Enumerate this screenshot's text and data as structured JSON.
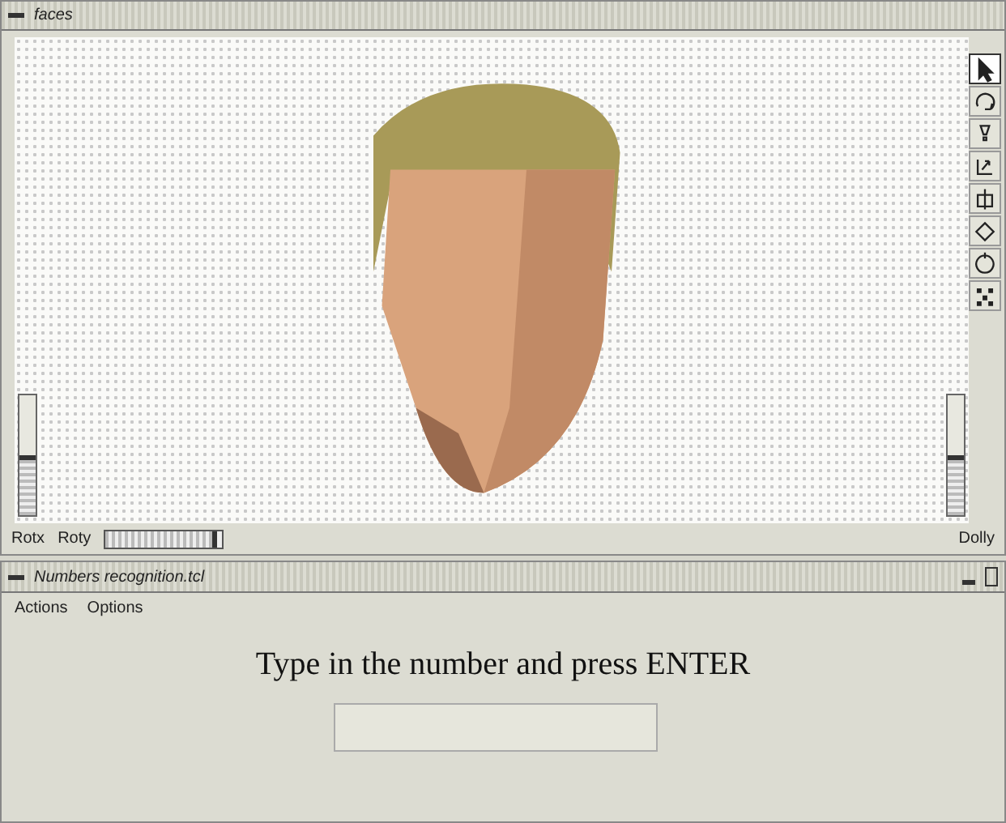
{
  "viewer_window": {
    "title": "faces",
    "tools": [
      {
        "kind": "pointer",
        "selected": true
      },
      {
        "kind": "rotate",
        "selected": false
      },
      {
        "kind": "light",
        "selected": false
      },
      {
        "kind": "zoom",
        "selected": false
      },
      {
        "kind": "pan",
        "selected": false
      },
      {
        "kind": "spin",
        "selected": false
      },
      {
        "kind": "orbit",
        "selected": false
      },
      {
        "kind": "points",
        "selected": false
      }
    ],
    "left_slider": {
      "level": 0.5
    },
    "right_slider": {
      "level": 0.5
    },
    "bottom_labels": [
      "Rotx",
      "Roty"
    ],
    "rot_slider": {
      "level": 0.95
    },
    "right_label": "Dolly"
  },
  "input_window": {
    "title": "Numbers recognition.tcl",
    "menu": [
      "Actions",
      "Options"
    ],
    "prompt": "Type in the number and press ENTER"
  }
}
